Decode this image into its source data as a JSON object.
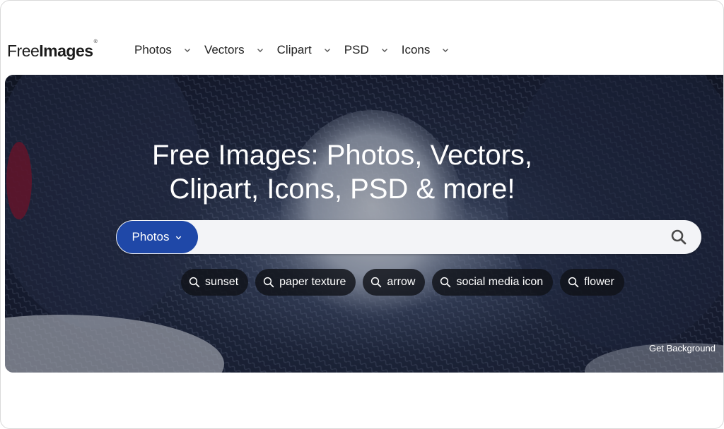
{
  "logo": {
    "part1": "Free",
    "part2": "Images",
    "mark": "®"
  },
  "nav": {
    "items": [
      {
        "label": "Photos"
      },
      {
        "label": "Vectors"
      },
      {
        "label": "Clipart"
      },
      {
        "label": "PSD"
      },
      {
        "label": "Icons"
      }
    ]
  },
  "hero": {
    "title_line1": "Free Images: Photos, Vectors,",
    "title_line2": "Clipart, Icons, PSD & more!",
    "background_link": "Get Background"
  },
  "search": {
    "type_label": "Photos",
    "placeholder": "",
    "value": ""
  },
  "tags": [
    {
      "label": "sunset"
    },
    {
      "label": "paper texture"
    },
    {
      "label": "arrow"
    },
    {
      "label": "social media icon"
    },
    {
      "label": "flower"
    }
  ],
  "colors": {
    "accent": "#1f48a8",
    "tag_bg": "#12141a",
    "hero_text": "#ffffff"
  },
  "icons": [
    "chevron-down-icon",
    "search-icon"
  ]
}
